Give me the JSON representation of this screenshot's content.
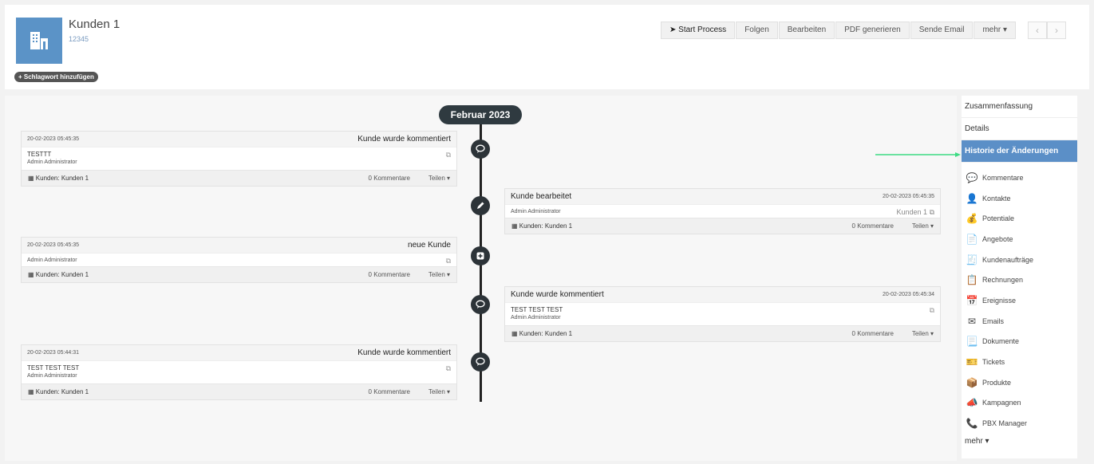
{
  "record": {
    "title": "Kunden 1",
    "number": "12345",
    "tag_button": "+ Schlagwort hinzufügen",
    "icon": "building-icon"
  },
  "actions": [
    {
      "label": "➤ Start Process",
      "icon": "send-icon"
    },
    {
      "label": "Folgen"
    },
    {
      "label": "Bearbeiten"
    },
    {
      "label": "PDF generieren"
    },
    {
      "label": "Sende Email"
    },
    {
      "label": "mehr ▾"
    }
  ],
  "pager": {
    "prev": "‹",
    "next": "›"
  },
  "timeline": {
    "month": "Februar 2023",
    "entries": [
      {
        "side": "left",
        "date": "20-02-2023 05:45:35",
        "title": "Kunde wurde kommentiert",
        "line1": "TESTTT",
        "line2": "Admin Administrator",
        "link": "",
        "related": "Kunden: Kunden 1",
        "comments": "0 Kommentare",
        "share": "Teilen ▾",
        "icon": "comment-icon"
      },
      {
        "side": "right",
        "date": "20-02-2023 05:45:35",
        "title": "Kunde bearbeitet",
        "line1": "",
        "line2": "Admin Administrator",
        "link": "Kunden 1",
        "related": "Kunden: Kunden 1",
        "comments": "0 Kommentare",
        "share": "Teilen ▾",
        "icon": "pencil-icon"
      },
      {
        "side": "left",
        "date": "20-02-2023 05:45:35",
        "title": "neue Kunde",
        "line1": "",
        "line2": "Admin Administrator",
        "link": "",
        "related": "Kunden: Kunden 1",
        "comments": "0 Kommentare",
        "share": "Teilen ▾",
        "icon": "plus-icon"
      },
      {
        "side": "right",
        "date": "20-02-2023 05:45:34",
        "title": "Kunde wurde kommentiert",
        "line1": "TEST TEST TEST",
        "line2": "Admin Administrator",
        "link": "",
        "related": "Kunden: Kunden 1",
        "comments": "0 Kommentare",
        "share": "Teilen ▾",
        "icon": "comment-icon"
      },
      {
        "side": "left",
        "date": "20-02-2023 05:44:31",
        "title": "Kunde wurde kommentiert",
        "line1": "TEST TEST TEST",
        "line2": "Admin Administrator",
        "link": "",
        "related": "Kunden: Kunden 1",
        "comments": "0 Kommentare",
        "share": "Teilen ▾",
        "icon": "comment-icon"
      }
    ]
  },
  "sidebar": {
    "sections": [
      "Zusammenfassung",
      "Details",
      "Historie der Änderungen"
    ],
    "active": "Historie der Änderungen",
    "links": [
      {
        "label": "Kommentare",
        "icon": "comment-icon",
        "glyph": "💬"
      },
      {
        "label": "Kontakte",
        "icon": "person-icon",
        "glyph": "👤"
      },
      {
        "label": "Potentiale",
        "icon": "money-bag-icon",
        "glyph": "💰"
      },
      {
        "label": "Angebote",
        "icon": "quote-icon",
        "glyph": "📄"
      },
      {
        "label": "Kundenaufträge",
        "icon": "sales-order-icon",
        "glyph": "🧾"
      },
      {
        "label": "Rechnungen",
        "icon": "invoice-icon",
        "glyph": "📋"
      },
      {
        "label": "Ereignisse",
        "icon": "calendar-icon",
        "glyph": "📅"
      },
      {
        "label": "Emails",
        "icon": "envelope-icon",
        "glyph": "✉"
      },
      {
        "label": "Dokumente",
        "icon": "document-icon",
        "glyph": "📃"
      },
      {
        "label": "Tickets",
        "icon": "ticket-icon",
        "glyph": "🎫"
      },
      {
        "label": "Produkte",
        "icon": "product-icon",
        "glyph": "📦"
      },
      {
        "label": "Kampagnen",
        "icon": "megaphone-icon",
        "glyph": "📣"
      },
      {
        "label": "PBX Manager",
        "icon": "phone-icon",
        "glyph": "📞"
      }
    ],
    "more": "mehr ▾"
  },
  "colors": {
    "accent": "#5b8fc7",
    "node": "#2c3338",
    "arrow": "#3ddc84"
  }
}
